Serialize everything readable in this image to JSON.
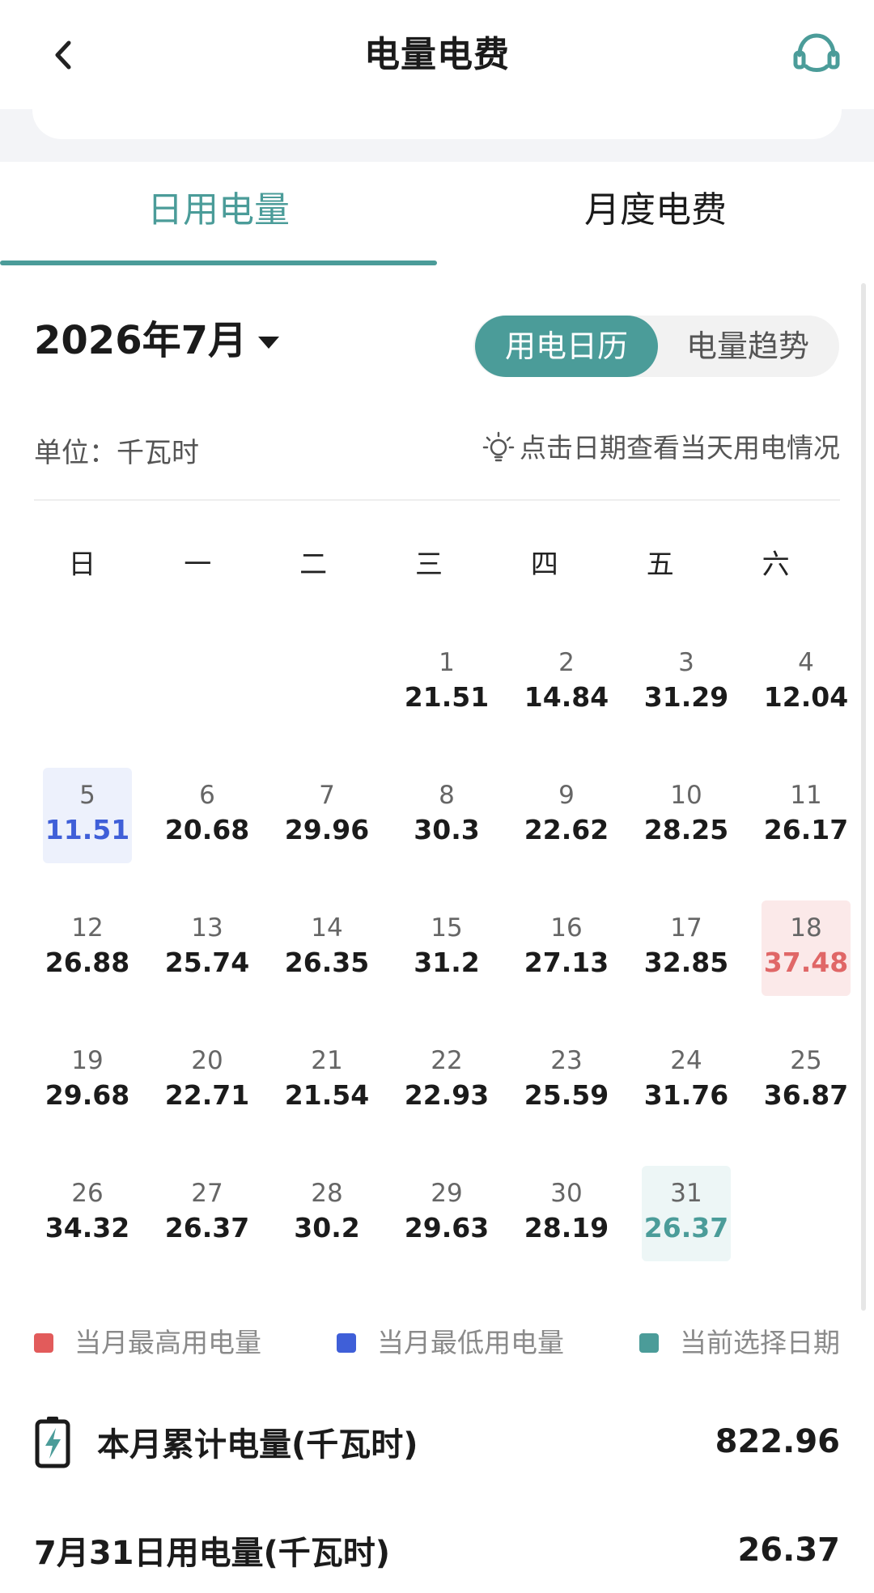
{
  "header": {
    "title": "电量电费"
  },
  "tabs": [
    {
      "label": "日用电量",
      "active": true
    },
    {
      "label": "月度电费",
      "active": false
    }
  ],
  "month_picker": {
    "label": "2026年7月"
  },
  "view_toggle": {
    "calendar": "用电日历",
    "trend": "电量趋势"
  },
  "unit_label": "单位：千瓦时",
  "hint": "点击日期查看当天用电情况",
  "weekdays": [
    "日",
    "一",
    "二",
    "三",
    "四",
    "五",
    "六"
  ],
  "days": [
    {
      "d": "1",
      "v": "21.51"
    },
    {
      "d": "2",
      "v": "14.84"
    },
    {
      "d": "3",
      "v": "31.29"
    },
    {
      "d": "4",
      "v": "12.04"
    },
    {
      "d": "5",
      "v": "11.51",
      "state": "low"
    },
    {
      "d": "6",
      "v": "20.68"
    },
    {
      "d": "7",
      "v": "29.96"
    },
    {
      "d": "8",
      "v": "30.3"
    },
    {
      "d": "9",
      "v": "22.62"
    },
    {
      "d": "10",
      "v": "28.25"
    },
    {
      "d": "11",
      "v": "26.17"
    },
    {
      "d": "12",
      "v": "26.88"
    },
    {
      "d": "13",
      "v": "25.74"
    },
    {
      "d": "14",
      "v": "26.35"
    },
    {
      "d": "15",
      "v": "31.2"
    },
    {
      "d": "16",
      "v": "27.13"
    },
    {
      "d": "17",
      "v": "32.85"
    },
    {
      "d": "18",
      "v": "37.48",
      "state": "high"
    },
    {
      "d": "19",
      "v": "29.68"
    },
    {
      "d": "20",
      "v": "22.71"
    },
    {
      "d": "21",
      "v": "21.54"
    },
    {
      "d": "22",
      "v": "22.93"
    },
    {
      "d": "23",
      "v": "25.59"
    },
    {
      "d": "24",
      "v": "31.76"
    },
    {
      "d": "25",
      "v": "36.87"
    },
    {
      "d": "26",
      "v": "34.32"
    },
    {
      "d": "27",
      "v": "26.37"
    },
    {
      "d": "28",
      "v": "30.2"
    },
    {
      "d": "29",
      "v": "29.63"
    },
    {
      "d": "30",
      "v": "28.19"
    },
    {
      "d": "31",
      "v": "26.37",
      "state": "sel"
    }
  ],
  "legend": [
    {
      "label": "当月最高用电量",
      "color": "#e25b5b"
    },
    {
      "label": "当月最低用电量",
      "color": "#3f5fd8"
    },
    {
      "label": "当前选择日期",
      "color": "#4b9c99"
    }
  ],
  "summary": {
    "total_label": "本月累计电量(千瓦时)",
    "total_value": "822.96",
    "daily_label": "7月31日用电量(千瓦时)",
    "daily_value": "26.37"
  },
  "colors": {
    "accent": "#4b9c99",
    "high": "#e06767",
    "low": "#3f5fd8"
  }
}
